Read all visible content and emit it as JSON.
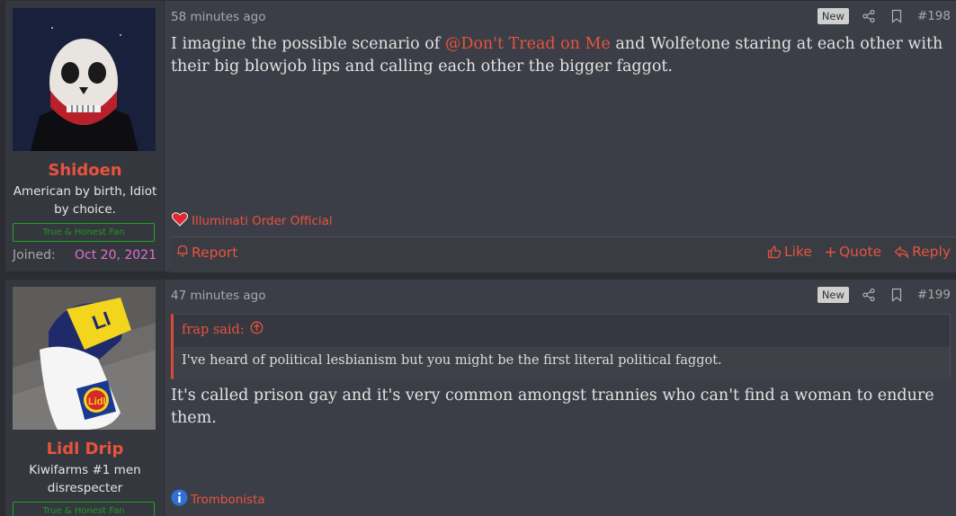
{
  "posts": [
    {
      "user": {
        "name": "Shidoen",
        "title": "American by birth, Idiot by choice.",
        "banner": "True & Honest Fan",
        "joined_label": "Joined:",
        "joined_date": "Oct 20, 2021"
      },
      "date": "58 minutes ago",
      "new_badge": "New",
      "number": "#198",
      "body_pre": "I imagine the possible scenario of ",
      "mention": "@Don't Tread on Me",
      "body_post": " and Wolfetone staring at each other with their big blowjob lips and calling each other the bigger faggot.",
      "reaction": "Illuminati Order Official",
      "report": "Report",
      "like": "Like",
      "quote": "Quote",
      "reply": "Reply"
    },
    {
      "user": {
        "name": "Lidl Drip",
        "title": "Kiwifarms #1 men disrespecter",
        "banner": "True & Honest Fan"
      },
      "date": "47 minutes ago",
      "new_badge": "New",
      "number": "#199",
      "quote_author": "frap said:",
      "quote_text": "I've heard of political lesbianism but you might be the first literal political faggot.",
      "body": "It's called prison gay and it's very common amongst trannies who can't find a woman to endure them.",
      "reaction": "Trombonista"
    }
  ],
  "colors": {
    "accent": "#e8533e",
    "joined": "#e26fd0",
    "banner": "#1ea51e"
  }
}
